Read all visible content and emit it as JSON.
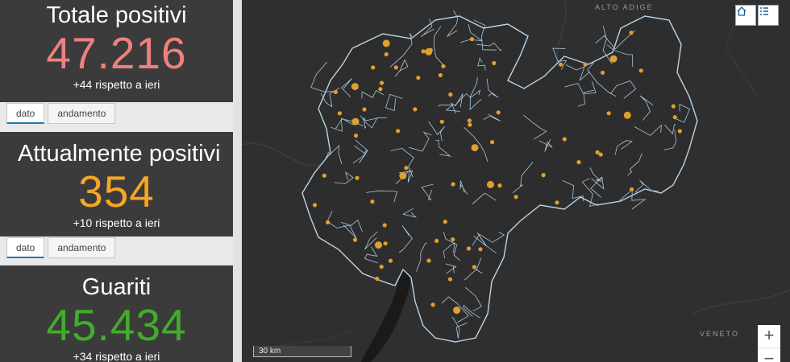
{
  "cards": [
    {
      "title": "Totale positivi",
      "value": "47.216",
      "delta": "+44 rispetto a ieri",
      "color": "#f08080"
    },
    {
      "title": "Attualmente positivi",
      "value": "354",
      "delta": "+10 rispetto a ieri",
      "color": "#f5a623"
    },
    {
      "title": "Guariti",
      "value": "45.434",
      "delta": "+34 rispetto a ieri",
      "color": "#3fae2a"
    }
  ],
  "tabs": {
    "data_label": "dato",
    "trend_label": "andamento"
  },
  "map": {
    "region_label_north": "ALTO ADIGE",
    "region_label_east": "VENETO",
    "scale_label": "30 km",
    "zoom_in": "+",
    "zoom_out": "−",
    "dot_color": "#e0a030",
    "boundary_color": "#b8d4ea"
  }
}
